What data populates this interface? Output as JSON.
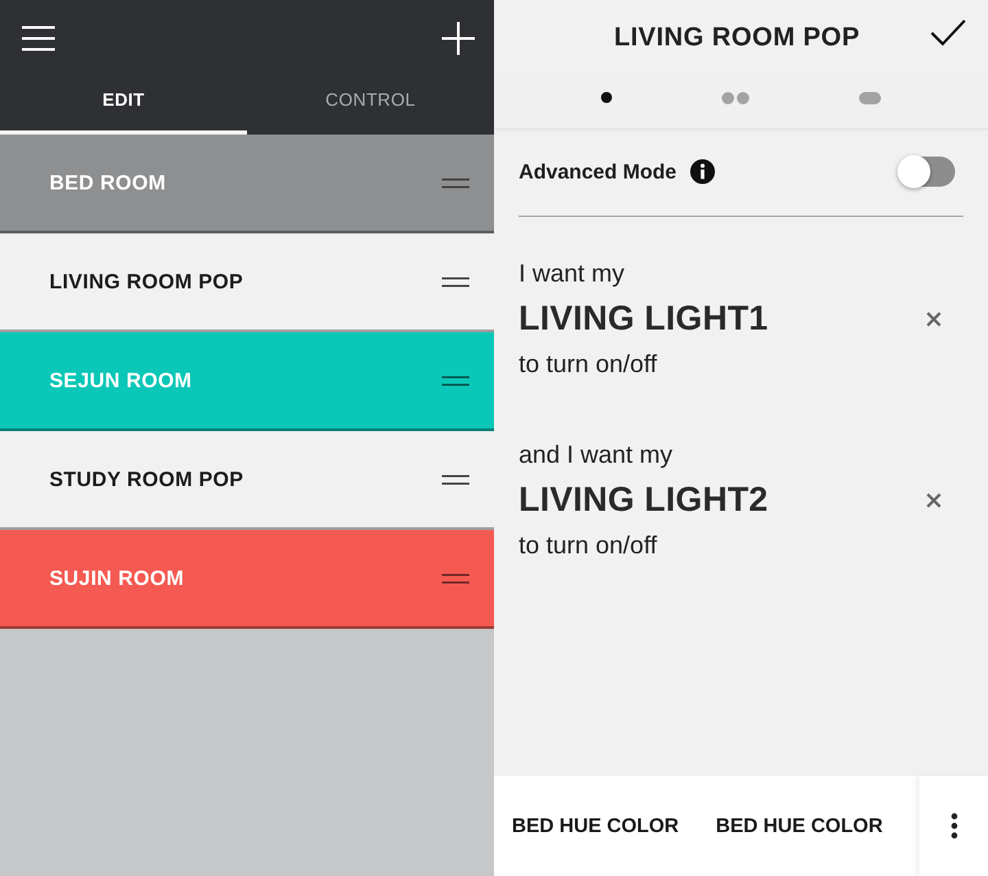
{
  "left_panel": {
    "tabs": [
      {
        "label": "EDIT",
        "selected": true
      },
      {
        "label": "CONTROL",
        "selected": false
      }
    ],
    "rooms": [
      {
        "name": "BED ROOM",
        "color": "#8e8f91"
      },
      {
        "name": "LIVING ROOM POP",
        "color": "#f1f1f1"
      },
      {
        "name": "SEJUN ROOM",
        "color": "#0bc7b7"
      },
      {
        "name": "STUDY ROOM POP",
        "color": "#f1f1f1"
      },
      {
        "name": "SUJIN ROOM",
        "color": "#f55a52"
      }
    ]
  },
  "editor": {
    "title": "LIVING ROOM POP",
    "steps": [
      {
        "kind": "dot",
        "selected": true
      },
      {
        "kind": "double",
        "selected": false
      },
      {
        "kind": "pill",
        "selected": false
      }
    ],
    "advanced_mode": {
      "label": "Advanced Mode",
      "on": false
    },
    "conditions": [
      {
        "intro": "I want my",
        "device": "LIVING LIGHT1",
        "action": "to turn on/off"
      },
      {
        "intro": "and I want my",
        "device": "LIVING LIGHT2",
        "action": "to turn on/off"
      }
    ],
    "bottom_bar": {
      "buttons": [
        "BED HUE COLOR",
        "BED HUE COLOR"
      ]
    }
  }
}
